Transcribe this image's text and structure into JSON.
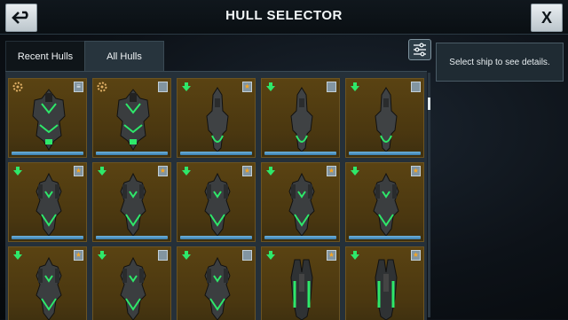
{
  "header": {
    "title": "HULL SELECTOR",
    "back_icon": "back-arrow-icon",
    "close_label": "X"
  },
  "tabs": [
    {
      "label": "Recent Hulls",
      "active": false
    },
    {
      "label": "All Hulls",
      "active": true
    }
  ],
  "filter": {
    "icon": "sliders-icon"
  },
  "details": {
    "text": "Select ship to see details."
  },
  "colors": {
    "card": "#4a3710",
    "accent": "#2ee86a",
    "bar": "#4c94c7",
    "star": "#f6a623"
  },
  "hulls": [
    {
      "rank": "gear",
      "badge": "chevron",
      "ship": "heavy"
    },
    {
      "rank": "gear",
      "badge": "blank",
      "ship": "heavy"
    },
    {
      "rank": "arrow",
      "badge": "star",
      "ship": "slim"
    },
    {
      "rank": "arrow",
      "badge": "blank",
      "ship": "slim"
    },
    {
      "rank": "arrow",
      "badge": "blank",
      "ship": "slim"
    },
    {
      "rank": "arrow",
      "badge": "star",
      "ship": "fighter"
    },
    {
      "rank": "arrow",
      "badge": "star",
      "ship": "fighter"
    },
    {
      "rank": "arrow",
      "badge": "star",
      "ship": "fighter"
    },
    {
      "rank": "arrow",
      "badge": "star",
      "ship": "fighter"
    },
    {
      "rank": "arrow",
      "badge": "star",
      "ship": "fighter"
    },
    {
      "rank": "arrow",
      "badge": "star",
      "ship": "fighter"
    },
    {
      "rank": "arrow",
      "badge": "blank",
      "ship": "fighter"
    },
    {
      "rank": "arrow",
      "badge": "blank",
      "ship": "fighter"
    },
    {
      "rank": "arrow",
      "badge": "star",
      "ship": "twin"
    },
    {
      "rank": "arrow",
      "badge": "star",
      "ship": "twin"
    }
  ]
}
